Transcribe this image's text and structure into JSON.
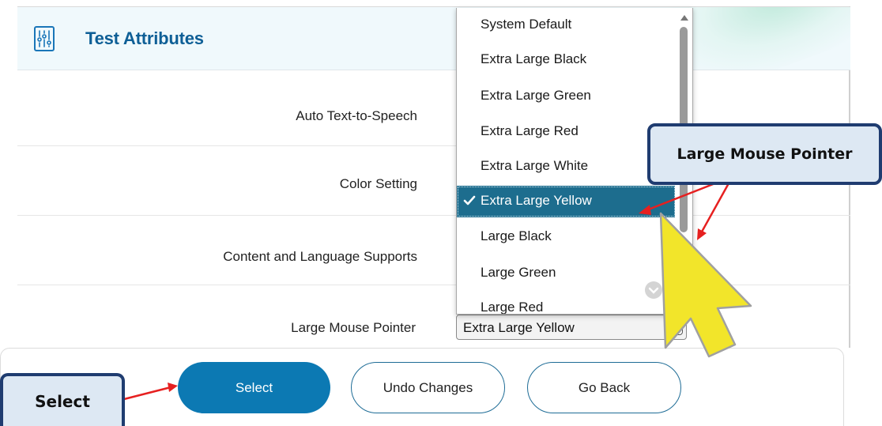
{
  "header": {
    "title": "Test Attributes",
    "icon": "sliders-icon"
  },
  "rows": [
    {
      "label": "Auto Text-to-Speech"
    },
    {
      "label": "Color Setting"
    },
    {
      "label": "Content and Language Supports"
    },
    {
      "label": "Large Mouse Pointer"
    }
  ],
  "select": {
    "value": "Extra Large Yellow"
  },
  "dropdown": {
    "options": [
      "System Default",
      "Extra Large Black",
      "Extra Large Green",
      "Extra Large Red",
      "Extra Large White",
      "Extra Large Yellow",
      "Large Black",
      "Large Green",
      "Large Red"
    ],
    "selected": "Extra Large Yellow"
  },
  "buttons": {
    "select": "Select",
    "undo": "Undo Changes",
    "back": "Go Back"
  },
  "callouts": {
    "pointer": "Large Mouse Pointer",
    "select": "Select"
  },
  "colors": {
    "accent": "#0c79b3",
    "selected_option": "#1d6d8e",
    "callout_border": "#1f3c70",
    "callout_fill": "#dde8f3",
    "arrow": "#e62020",
    "cursor": "#f2e52a"
  }
}
